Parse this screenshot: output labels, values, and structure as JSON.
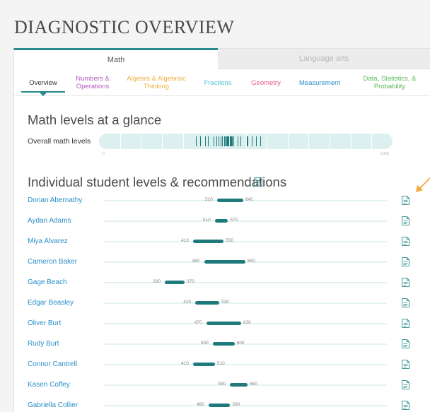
{
  "page": {
    "title": "DIAGNOSTIC OVERVIEW"
  },
  "subject_tabs": [
    {
      "label": "Math",
      "active": true
    },
    {
      "label": "Language arts",
      "active": false
    }
  ],
  "sub_tabs": [
    {
      "label": "Overview",
      "color": "#333333",
      "active": true
    },
    {
      "label": "Numbers & Operations",
      "color": "#b45bbb",
      "active": false
    },
    {
      "label": "Algebra & Algebraic Thinking",
      "color": "#f0b041",
      "active": false
    },
    {
      "label": "Fractions",
      "color": "#50c4d8",
      "active": false
    },
    {
      "label": "Geometry",
      "color": "#e8548a",
      "active": false
    },
    {
      "label": "Measurement",
      "color": "#2b8cc4",
      "active": false
    },
    {
      "label": "Data, Statistics, & Probability",
      "color": "#5cb85c",
      "active": false
    }
  ],
  "glance": {
    "heading": "Math levels at a glance",
    "overall_label": "Overall math levels",
    "axis_min": "0",
    "axis_max": "1300",
    "scale": [
      0,
      1300
    ],
    "student_levels": [
      430,
      448,
      470,
      483,
      508,
      519,
      528,
      539,
      545,
      553,
      558,
      563,
      568,
      573,
      578,
      584,
      589,
      594,
      614,
      625,
      656,
      676,
      694,
      715
    ]
  },
  "individual": {
    "heading": "Individual student levels & recommendations",
    "scale": [
      0,
      1300
    ],
    "students": [
      {
        "name": "Dorian Abernathy",
        "low": 520,
        "high": 640
      },
      {
        "name": "Aydan Adams",
        "low": 510,
        "high": 570
      },
      {
        "name": "Miya Alvarez",
        "low": 410,
        "high": 550
      },
      {
        "name": "Cameron Baker",
        "low": 460,
        "high": 650
      },
      {
        "name": "Gage Beach",
        "low": 280,
        "high": 370
      },
      {
        "name": "Edgar Beasley",
        "low": 420,
        "high": 530
      },
      {
        "name": "Oliver Burt",
        "low": 470,
        "high": 630
      },
      {
        "name": "Rudy Burt",
        "low": 500,
        "high": 600
      },
      {
        "name": "Connor Cantrell",
        "low": 410,
        "high": 510
      },
      {
        "name": "Kasen Coffey",
        "low": 580,
        "high": 660
      },
      {
        "name": "Gabriella Collier",
        "low": 480,
        "high": 580
      }
    ]
  },
  "colors": {
    "accent": "#2a8a8c",
    "link": "#2a8ec9",
    "arrow": "#f5a742"
  }
}
